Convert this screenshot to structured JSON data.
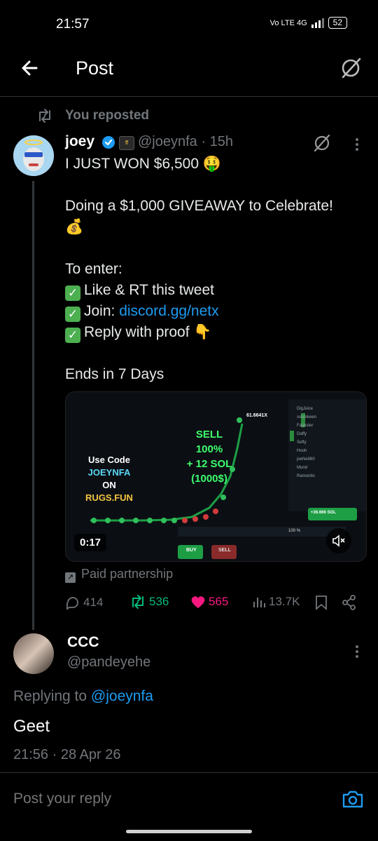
{
  "status": {
    "time": "21:57",
    "network": "Vo LTE 4G",
    "battery": "52"
  },
  "header": {
    "title": "Post"
  },
  "repost": {
    "label": "You reposted"
  },
  "post": {
    "name": "joey",
    "handle": "@joeynfa · 15h",
    "line1": "I JUST WON $6,500 🤑",
    "line2": "Doing a $1,000 GIVEAWAY to Celebrate!",
    "line2_emoji": "💰",
    "line3": "To enter:",
    "bullet1": "Like & RT this tweet",
    "bullet2_prefix": "Join: ",
    "bullet2_link": "discord.gg/netx",
    "bullet3": "Reply with proof 👇",
    "line4": "Ends in 7 Days",
    "media": {
      "duration": "0:17",
      "promo_use": "Use Code",
      "promo_code": "JOEYNFA",
      "promo_on": "ON",
      "promo_site": "RUGS.FUN",
      "sell_lines": [
        "SELL",
        "100%",
        "+ 12 SOL",
        "(1000$)"
      ],
      "multiplier": "61.6641X",
      "buy_label": "BUY",
      "sell_btn": "SELL",
      "balance": "+36.666 SOL",
      "pct": "100 %",
      "players": [
        "DigJuice",
        "sobrokeen",
        "Fatjester",
        "Daffy",
        "Sefty",
        "Hooh",
        "joeNe960",
        "Mund",
        "Ramonito"
      ]
    },
    "paid": "Paid partnership",
    "stats": {
      "replies": "414",
      "reposts": "536",
      "likes": "565",
      "views": "13.7K"
    }
  },
  "reply": {
    "name": "CCC",
    "handle": "@pandeyehe",
    "replying_prefix": "Replying to ",
    "replying_handle": "@joeynfa",
    "body": "Geet",
    "timestamp": "21:56 · 28 Apr 26"
  },
  "composer": {
    "placeholder": "Post your reply"
  },
  "colors": {
    "accent": "#1d9bf0",
    "repost_green": "#00ba7c",
    "like_pink": "#f91880",
    "muted": "#71767b"
  }
}
